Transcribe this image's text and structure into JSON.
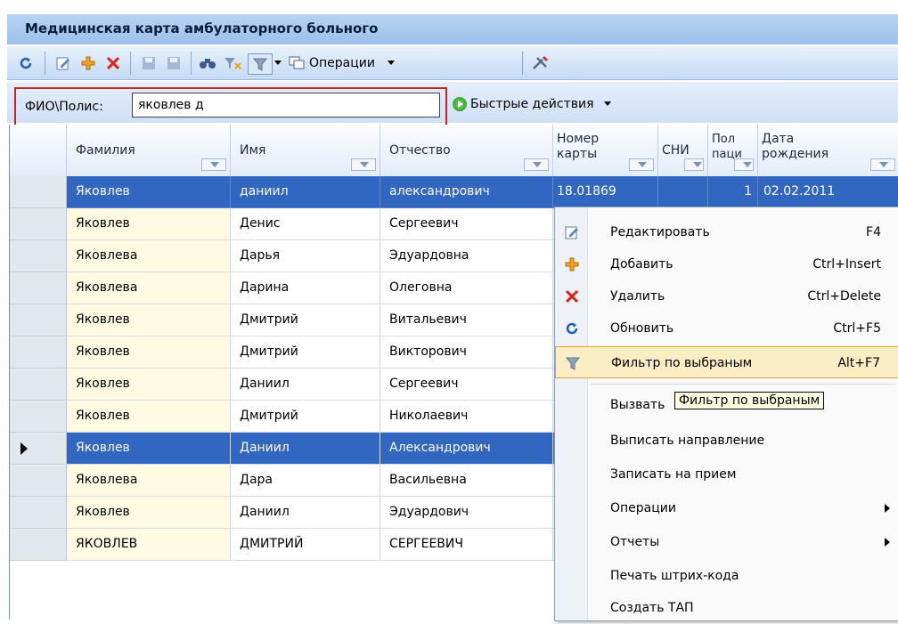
{
  "window": {
    "title": "Медицинская карта амбулаторного больного"
  },
  "toolbar": {
    "operations_label": "Операции"
  },
  "search": {
    "label": "ФИО\\Полис:",
    "value": "яковлев д",
    "quick_actions_label": "Быстрые действия"
  },
  "grid": {
    "columns": [
      {
        "label": "Фамилия"
      },
      {
        "label": "Имя"
      },
      {
        "label": "Отчество"
      },
      {
        "label": "Номер карты"
      },
      {
        "label": "СНИ"
      },
      {
        "label": "Пол паци"
      },
      {
        "label": "Дата рождения"
      }
    ],
    "rows": [
      {
        "last": "Яковлев",
        "first": "даниил",
        "middle": "александрович",
        "card": "18.01869",
        "sex": "1",
        "birth": "02.02.2011"
      },
      {
        "last": "Яковлев",
        "first": "Денис",
        "middle": "Сергеевич",
        "card": "",
        "sex": "",
        "birth": ""
      },
      {
        "last": "Яковлева",
        "first": "Дарья",
        "middle": "Эдуардовна",
        "card": "",
        "sex": "",
        "birth": ""
      },
      {
        "last": "Яковлева",
        "first": "Дарина",
        "middle": "Олеговна",
        "card": "",
        "sex": "",
        "birth": ""
      },
      {
        "last": "Яковлев",
        "first": "Дмитрий",
        "middle": "Витальевич",
        "card": "",
        "sex": "",
        "birth": ""
      },
      {
        "last": "Яковлев",
        "first": "Дмитрий",
        "middle": "Викторович",
        "card": "",
        "sex": "",
        "birth": ""
      },
      {
        "last": "Яковлев",
        "first": "Даниил",
        "middle": "Сергеевич",
        "card": "",
        "sex": "",
        "birth": ""
      },
      {
        "last": "Яковлев",
        "first": "Дмитрий",
        "middle": "Николаевич",
        "card": "",
        "sex": "",
        "birth": ""
      },
      {
        "last": "Яковлев",
        "first": "Даниил",
        "middle": "Александрович",
        "card": "",
        "sex": "",
        "birth": ""
      },
      {
        "last": "Яковлева",
        "first": "Дара",
        "middle": "Васильевна",
        "card": "",
        "sex": "",
        "birth": ""
      },
      {
        "last": "Яковлев",
        "first": "Даниил",
        "middle": "Эдуардович",
        "card": "",
        "sex": "",
        "birth": ""
      },
      {
        "last": "ЯКОВЛЕВ",
        "first": "ДМИТРИЙ",
        "middle": "СЕРГЕЕВИЧ",
        "card": "",
        "sex": "",
        "birth": ""
      }
    ]
  },
  "context_menu": {
    "items": [
      {
        "label": "Редактировать",
        "shortcut": "F4"
      },
      {
        "label": "Добавить",
        "shortcut": "Ctrl+Insert"
      },
      {
        "label": "Удалить",
        "shortcut": "Ctrl+Delete"
      },
      {
        "label": "Обновить",
        "shortcut": "Ctrl+F5"
      },
      {
        "label": "Фильтр по выбраным",
        "shortcut": "Alt+F7"
      },
      {
        "label": "Вызвать"
      },
      {
        "label": "Выписать направление"
      },
      {
        "label": "Записать на прием"
      },
      {
        "label": "Операции"
      },
      {
        "label": "Отчеты"
      },
      {
        "label": "Печать штрих-кода"
      },
      {
        "label": "Создать ТАП"
      }
    ]
  },
  "tooltip": {
    "text": "Фильтр по выбраным"
  },
  "colors": {
    "selection": "#3167c0",
    "menu_highlight": "#fbeec4",
    "delete_icon": "#e0201c",
    "add_icon": "#f0a21a"
  }
}
